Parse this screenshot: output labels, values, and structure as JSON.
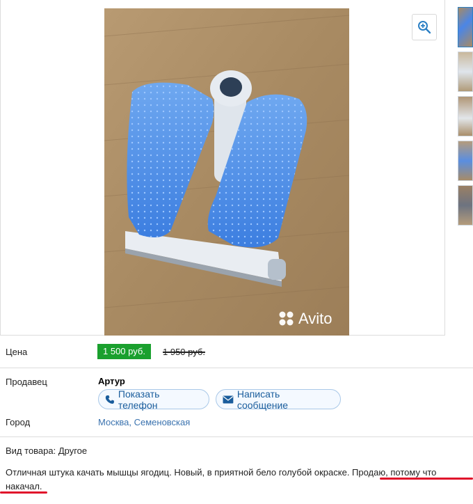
{
  "listing": {
    "watermark": "Avito",
    "price_label": "Цена",
    "price": "1 500 руб.",
    "old_price": "1 950 руб.",
    "seller_label": "Продавец",
    "seller_name": "Артур",
    "show_phone_label": "Показать телефон",
    "write_message_label": "Написать сообщение",
    "city_label": "Город",
    "city_value": "Москва, Семеновская",
    "goods_type": "Вид товара: Другое",
    "description_line1": "Отличная штука качать мышцы ягодиц. Новый, в приятной бело голубой окраске. Продаю, потому что",
    "description_line2": "накачал."
  },
  "colors": {
    "price_badge": "#1aa02e",
    "link": "#3b73af",
    "highlight_underline": "#e0102a"
  },
  "icons": {
    "zoom": "zoom-in-icon",
    "phone": "phone-icon",
    "message": "envelope-icon"
  }
}
